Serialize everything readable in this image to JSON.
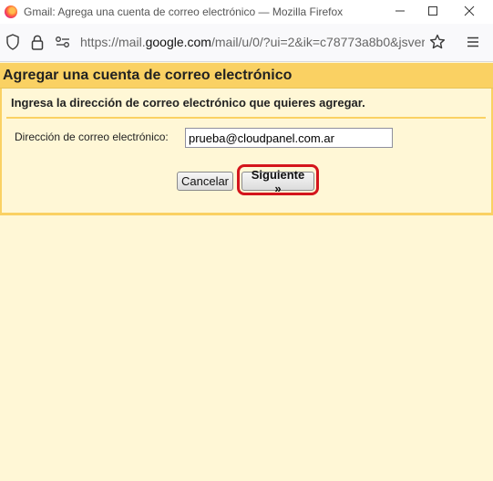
{
  "window": {
    "title": "Gmail: Agrega una cuenta de correo electrónico — Mozilla Firefox",
    "minimize": "—",
    "maximize": "☐",
    "close": "✕"
  },
  "urlbar": {
    "url_prefix": "https://mail.",
    "url_domain": "google.com",
    "url_suffix": "/mail/u/0/?ui=2&ik=c78773a8b0&jsver"
  },
  "dialog": {
    "title": "Agregar una cuenta de correo electrónico",
    "instructions": "Ingresa la dirección de correo electrónico que quieres agregar.",
    "email_label": "Dirección de correo electrónico:",
    "email_value": "prueba@cloudpanel.com.ar",
    "cancel_label": "Cancelar",
    "next_label": "Siguiente »"
  },
  "colors": {
    "header": "#fad163",
    "background": "#fff7d6",
    "highlight": "#d4151c"
  }
}
